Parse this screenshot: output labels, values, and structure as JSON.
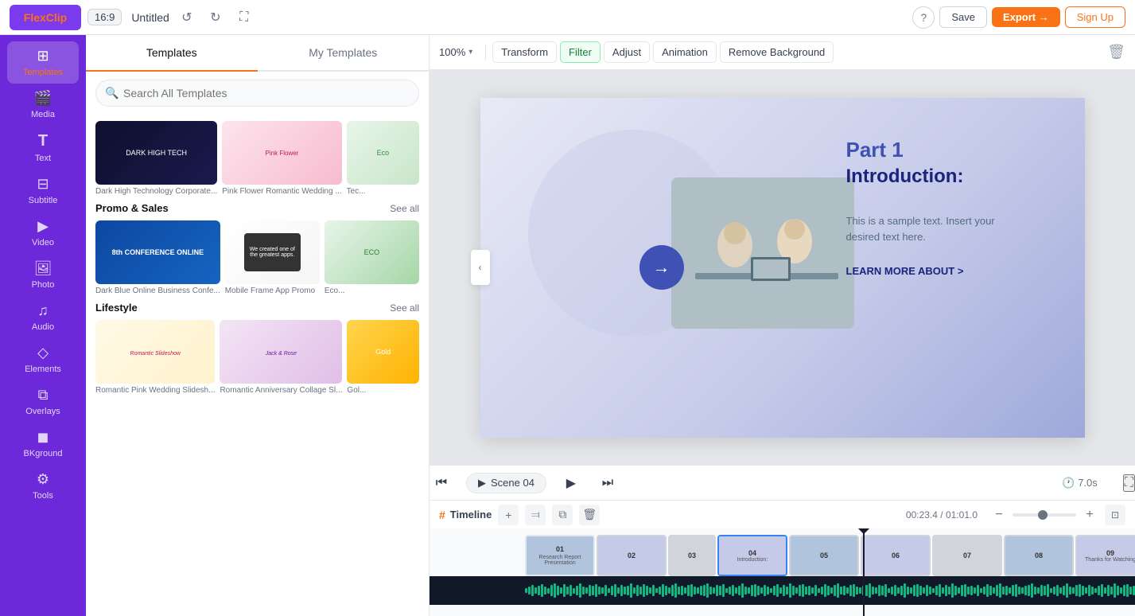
{
  "app": {
    "logo": "FlexClip",
    "logo_f": "F",
    "logo_rest": "lexClip"
  },
  "topbar": {
    "ratio": "16:9",
    "title": "Untitled",
    "undo_label": "↺",
    "redo_label": "↻",
    "fullscreen_label": "⛶",
    "help_label": "?",
    "save_label": "Save",
    "export_label": "Export →",
    "signup_label": "Sign Up"
  },
  "sidebar": {
    "items": [
      {
        "id": "templates",
        "label": "Templates",
        "icon": "⊞",
        "active": true
      },
      {
        "id": "media",
        "label": "Media",
        "icon": "🎬"
      },
      {
        "id": "text",
        "label": "Text",
        "icon": "T"
      },
      {
        "id": "subtitle",
        "label": "Subtitle",
        "icon": "⊟"
      },
      {
        "id": "video",
        "label": "Video",
        "icon": "▶"
      },
      {
        "id": "photo",
        "label": "Photo",
        "icon": "🖼"
      },
      {
        "id": "audio",
        "label": "Audio",
        "icon": "♪"
      },
      {
        "id": "elements",
        "label": "Elements",
        "icon": "◇"
      },
      {
        "id": "overlays",
        "label": "Overlays",
        "icon": "⧉"
      },
      {
        "id": "bkground",
        "label": "BKground",
        "icon": "◼"
      },
      {
        "id": "tools",
        "label": "Tools",
        "icon": "⚙"
      }
    ]
  },
  "templates_panel": {
    "tab_templates": "Templates",
    "tab_my_templates": "My Templates",
    "search_placeholder": "Search All Templates",
    "promo_section": "Promo & Sales",
    "lifestyle_section": "Lifestyle",
    "see_all": "See all",
    "templates": [
      {
        "id": 1,
        "label": "Dark High Technology Corporate..."
      },
      {
        "id": 2,
        "label": "Pink Flower Romantic Wedding ..."
      },
      {
        "id": 3,
        "label": "Tec..."
      },
      {
        "id": 4,
        "label": "Dark Blue Online Business Confe..."
      },
      {
        "id": 5,
        "label": "Mobile Frame App Promo"
      },
      {
        "id": 6,
        "label": "Eco..."
      },
      {
        "id": 7,
        "label": "Romantic Pink Wedding Slidesh..."
      },
      {
        "id": 8,
        "label": "Romantic Anniversary Collage Sl..."
      },
      {
        "id": 9,
        "label": "Gol..."
      }
    ]
  },
  "toolbar": {
    "zoom_label": "100%",
    "transform_label": "Transform",
    "filter_label": "Filter",
    "adjust_label": "Adjust",
    "animation_label": "Animation",
    "remove_bg_label": "Remove Background"
  },
  "canvas": {
    "part_label": "Part 1",
    "heading": "Introduction:",
    "body_text": "This is a sample text. Insert your desired text here.",
    "cta": "LEARN MORE ABOUT >"
  },
  "scene_controls": {
    "scene_label": "Scene 04",
    "time_label": "7.0s"
  },
  "timeline": {
    "label": "Timeline",
    "time_position": "00:23.4 / 01:01.0",
    "scenes": [
      {
        "id": "01",
        "label": "Research Report Presentation"
      },
      {
        "id": "02",
        "label": ""
      },
      {
        "id": "03",
        "label": ""
      },
      {
        "id": "04",
        "label": "Introduction:",
        "active": true
      },
      {
        "id": "05",
        "label": ""
      },
      {
        "id": "06",
        "label": ""
      },
      {
        "id": "07",
        "label": ""
      },
      {
        "id": "08",
        "label": ""
      },
      {
        "id": "09",
        "label": "Thanks for Watching"
      }
    ]
  }
}
